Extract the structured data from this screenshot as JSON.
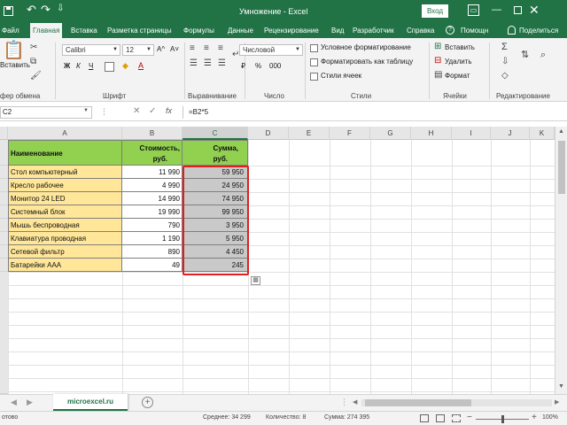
{
  "titlebar": {
    "title": "Умножение - Excel",
    "signin_label": "Вход",
    "qat_more": "⇩"
  },
  "menu": {
    "tabs": [
      "Файл",
      "Главная",
      "Вставка",
      "Разметка страницы",
      "Формулы",
      "Данные",
      "Рецензирование",
      "Вид",
      "Разработчик",
      "Справка"
    ],
    "active_tab": "Главная",
    "help_label": "Помощн",
    "share_label": "Поделиться"
  },
  "ribbon": {
    "clipboard": {
      "paste_label": "Вставить",
      "group_label": "фер обмена"
    },
    "font": {
      "font_name": "Calibri",
      "font_size": "12",
      "bold": "Ж",
      "italic": "К",
      "underline": "Ч",
      "grow": "A^",
      "shrink": "A˅",
      "font_color": "A",
      "fill_color": "◆",
      "group_label": "Шрифт"
    },
    "alignment": {
      "group_label": "Выравнивание"
    },
    "number": {
      "format": "Числовой",
      "currency": "₽",
      "percent": "%",
      "thousands": "000",
      "group_label": "Число"
    },
    "styles": {
      "conditional": "Условное форматирование",
      "table": "Форматировать как таблицу",
      "cell_styles": "Стили ячеек",
      "group_label": "Стили"
    },
    "cells": {
      "insert": "Вставить",
      "delete": "Удалить",
      "format": "Формат",
      "group_label": "Ячейки"
    },
    "editing": {
      "group_label": "Редактирование"
    }
  },
  "formula_bar": {
    "name_box": "C2",
    "formula": "=B2*5",
    "fx": "fx",
    "cancel": "✕",
    "enter": "✓",
    "dots": "⋮"
  },
  "grid": {
    "columns": [
      "A",
      "B",
      "C",
      "D",
      "E",
      "F",
      "G",
      "H",
      "I",
      "J",
      "K"
    ],
    "selected_column": "C",
    "header": {
      "name": "Наименование",
      "cost_line1": "Стоимость,",
      "cost_line2": "руб.",
      "sum_line1": "Сумма,",
      "sum_line2": "руб."
    },
    "rows": [
      {
        "name": "Стол компьютерный",
        "cost": "11 990",
        "sum": "59 950"
      },
      {
        "name": "Кресло рабочее",
        "cost": "4 990",
        "sum": "24 950"
      },
      {
        "name": "Монитор 24 LED",
        "cost": "14 990",
        "sum": "74 950"
      },
      {
        "name": "Системный блок",
        "cost": "19 990",
        "sum": "99 950"
      },
      {
        "name": "Мышь беспроводная",
        "cost": "790",
        "sum": "3 950"
      },
      {
        "name": "Клавиатура проводная",
        "cost": "1 190",
        "sum": "5 950"
      },
      {
        "name": "Сетевой фильтр",
        "cost": "890",
        "sum": "4 450"
      },
      {
        "name": "Батарейки ААА",
        "cost": "49",
        "sum": "245"
      }
    ]
  },
  "sheets": {
    "tabs": [
      "microexcel.ru"
    ],
    "add_label": "+",
    "prev": "◀",
    "next": "▶"
  },
  "statusbar": {
    "ready": "отово",
    "average": "Среднее: 34 299",
    "count": "Количество: 8",
    "sum": "Сумма: 274 395",
    "zoom_minus": "−",
    "zoom_plus": "+",
    "zoom_level": "100%",
    "zoom_fraction": 0.5
  },
  "colors": {
    "accent": "#217346",
    "header_fill": "#92d050",
    "name_fill": "#ffe699",
    "selected_fill": "#c9c9c9",
    "highlight_border": "#e02020"
  }
}
